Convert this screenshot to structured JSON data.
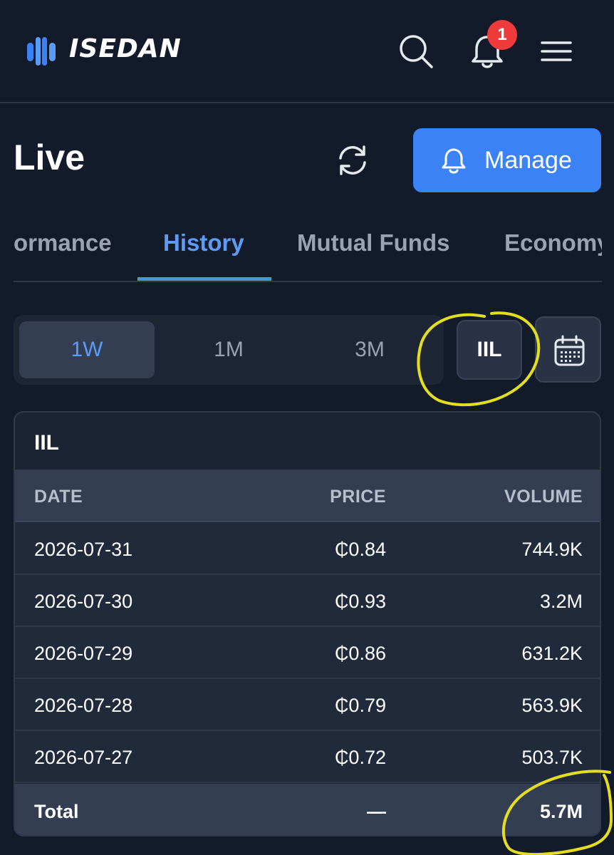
{
  "header": {
    "brand": "ISEDAN",
    "notification_count": "1"
  },
  "page": {
    "title": "Live",
    "manage_label": "Manage"
  },
  "tabs": [
    {
      "label": "ormance",
      "active": false
    },
    {
      "label": "History",
      "active": true
    },
    {
      "label": "Mutual Funds",
      "active": false
    },
    {
      "label": "Economy",
      "active": false
    }
  ],
  "periods": [
    {
      "label": "1W",
      "active": true
    },
    {
      "label": "1M",
      "active": false
    },
    {
      "label": "3M",
      "active": false
    }
  ],
  "ticker_button": "IIL",
  "table": {
    "title": "IIL",
    "columns": [
      "DATE",
      "PRICE",
      "VOLUME"
    ],
    "rows": [
      {
        "date": "2026-07-31",
        "price": "₵0.84",
        "volume": "744.9K"
      },
      {
        "date": "2026-07-30",
        "price": "₵0.93",
        "volume": "3.2M"
      },
      {
        "date": "2026-07-29",
        "price": "₵0.86",
        "volume": "631.2K"
      },
      {
        "date": "2026-07-28",
        "price": "₵0.79",
        "volume": "563.9K"
      },
      {
        "date": "2026-07-27",
        "price": "₵0.72",
        "volume": "503.7K"
      }
    ],
    "total": {
      "label": "Total",
      "price": "—",
      "volume": "5.7M"
    }
  },
  "colors": {
    "background": "#131b2b",
    "accent": "#3b82f6",
    "active_tab": "#5b9cf6",
    "badge": "#ef3b3b",
    "annotation": "#e3df1e"
  }
}
